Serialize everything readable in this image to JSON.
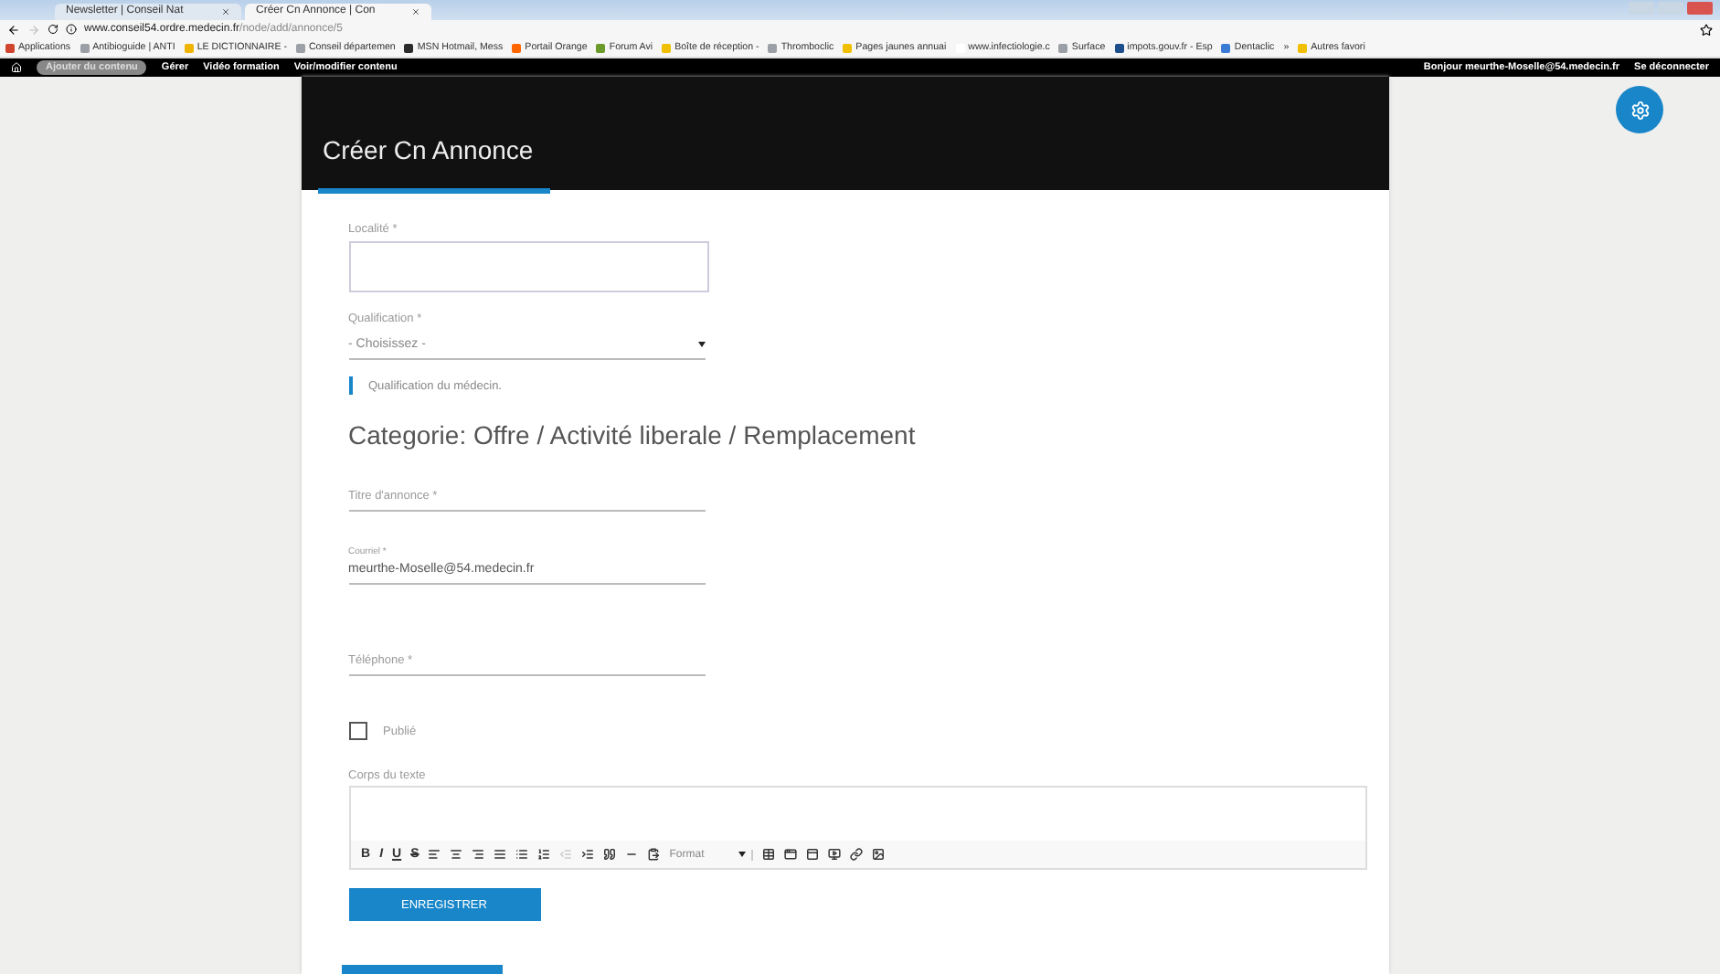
{
  "browser": {
    "tabs": [
      {
        "label": "Newsletter | Conseil Nat",
        "selected": false
      },
      {
        "label": "Créer Cn Annonce | Con",
        "selected": true
      }
    ],
    "url": {
      "host": "www.conseil54.ordre.medecin.fr",
      "path": "/node/add/annonce/5"
    },
    "bookmarks": [
      {
        "label": "Applications",
        "color": "#d0452f"
      },
      {
        "label": "Antibioguide | ANTI",
        "color": "#9aa0a6"
      },
      {
        "label": "LE DICTIONNAIRE - ",
        "color": "#f0b400"
      },
      {
        "label": "Conseil départemen",
        "color": "#9aa0a6"
      },
      {
        "label": "MSN Hotmail, Mess",
        "color": "#2b2b2b"
      },
      {
        "label": "Portail Orange",
        "color": "#ff6600"
      },
      {
        "label": "Forum Avi",
        "color": "#6a9a2a"
      },
      {
        "label": "Boîte de réception - ",
        "color": "#f0c000"
      },
      {
        "label": "Thromboclic",
        "color": "#9aa0a6"
      },
      {
        "label": "Pages jaunes annuai",
        "color": "#f0c000"
      },
      {
        "label": "www.infectiologie.c",
        "color": "#ffffff"
      },
      {
        "label": "Surface",
        "color": "#9aa0a6"
      },
      {
        "label": "impots.gouv.fr - Esp",
        "color": "#1e4d8c"
      },
      {
        "label": "Dentaclic",
        "color": "#3a7bd5"
      }
    ],
    "more": "»",
    "other": "Autres favori"
  },
  "admin_bar": {
    "items": [
      {
        "label": "Ajouter du contenu",
        "selected": true
      },
      {
        "label": "Gérer",
        "selected": false
      },
      {
        "label": "Vidéo formation",
        "selected": false
      },
      {
        "label": "Voir/modifier contenu",
        "selected": false
      }
    ],
    "greeting": "Bonjour meurthe-Moselle@54.medecin.fr",
    "logout": "Se déconnecter"
  },
  "page": {
    "title": "Créer Cn Annonce",
    "localite": {
      "label": "Localité *"
    },
    "qualification": {
      "label": "Qualification *",
      "value": "- Choisissez -",
      "help": "Qualification du médecin."
    },
    "category": "Categorie: Offre / Activité liberale / Remplacement",
    "titre": {
      "label": "Titre d'annonce *"
    },
    "courriel": {
      "label": "Courriel *",
      "value": "meurthe-Moselle@54.medecin.fr"
    },
    "telephone": {
      "label": "Téléphone *"
    },
    "publie": {
      "label": "Publié",
      "checked": false
    },
    "body": {
      "label": "Corps du texte",
      "toolbar": {
        "marks": [
          "B",
          "I",
          "U",
          "S"
        ],
        "outdent": {
          "disabled": true
        },
        "indent": {
          "disabled": false
        },
        "format": "Format"
      }
    },
    "submit": "ENREGISTRER"
  }
}
